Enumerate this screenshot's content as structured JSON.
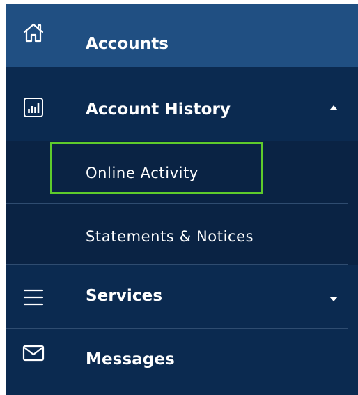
{
  "nav": {
    "accounts": {
      "label": "Accounts",
      "icon": "home-icon"
    },
    "account_history": {
      "label": "Account History",
      "icon": "bar-chart-icon",
      "expanded": true,
      "children": [
        {
          "label": "Online Activity",
          "highlighted": true
        },
        {
          "label": "Statements & Notices"
        }
      ]
    },
    "services": {
      "label": "Services",
      "icon": "hamburger-icon",
      "expanded": false
    },
    "messages": {
      "label": "Messages",
      "icon": "envelope-icon"
    }
  },
  "colors": {
    "nav_background": "#0b2a50",
    "subnav_background": "#0a2344",
    "active_item_background": "#204f82",
    "highlight_border": "#5ecb2c",
    "text": "#ffffff"
  }
}
